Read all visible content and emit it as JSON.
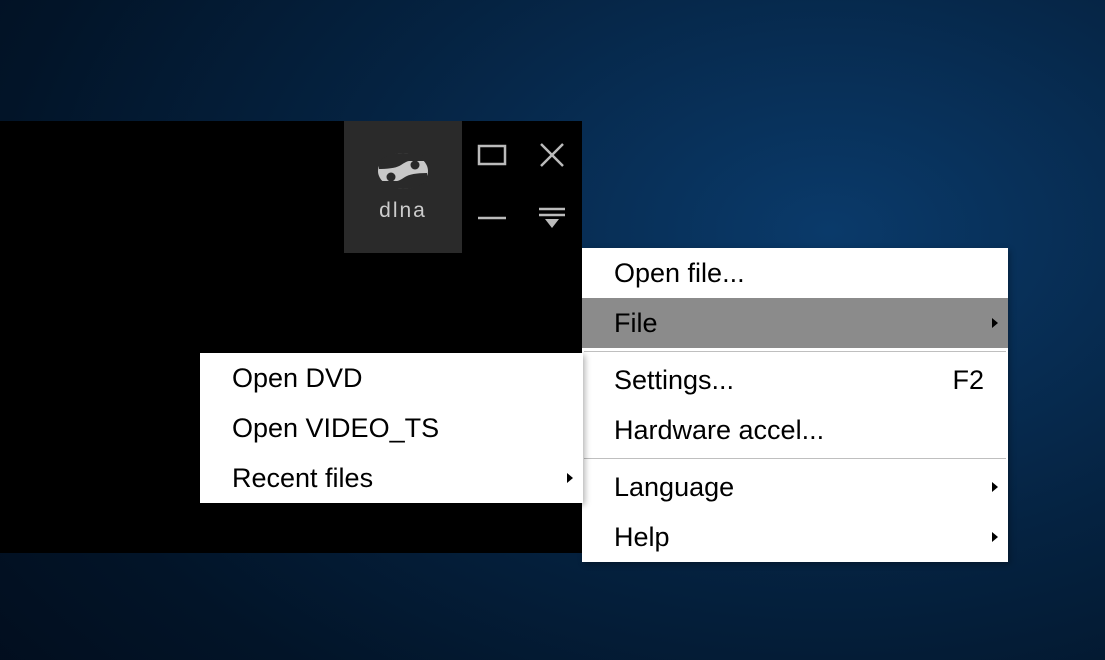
{
  "titlebar": {
    "dlna_label": "dlna"
  },
  "main_menu": {
    "open_file": "Open file...",
    "file": "File",
    "settings": "Settings...",
    "settings_shortcut": "F2",
    "hardware_accel": "Hardware accel...",
    "language": "Language",
    "help": "Help"
  },
  "sub_menu": {
    "open_dvd": "Open DVD",
    "open_video_ts": "Open VIDEO_TS",
    "recent_files": "Recent files"
  }
}
